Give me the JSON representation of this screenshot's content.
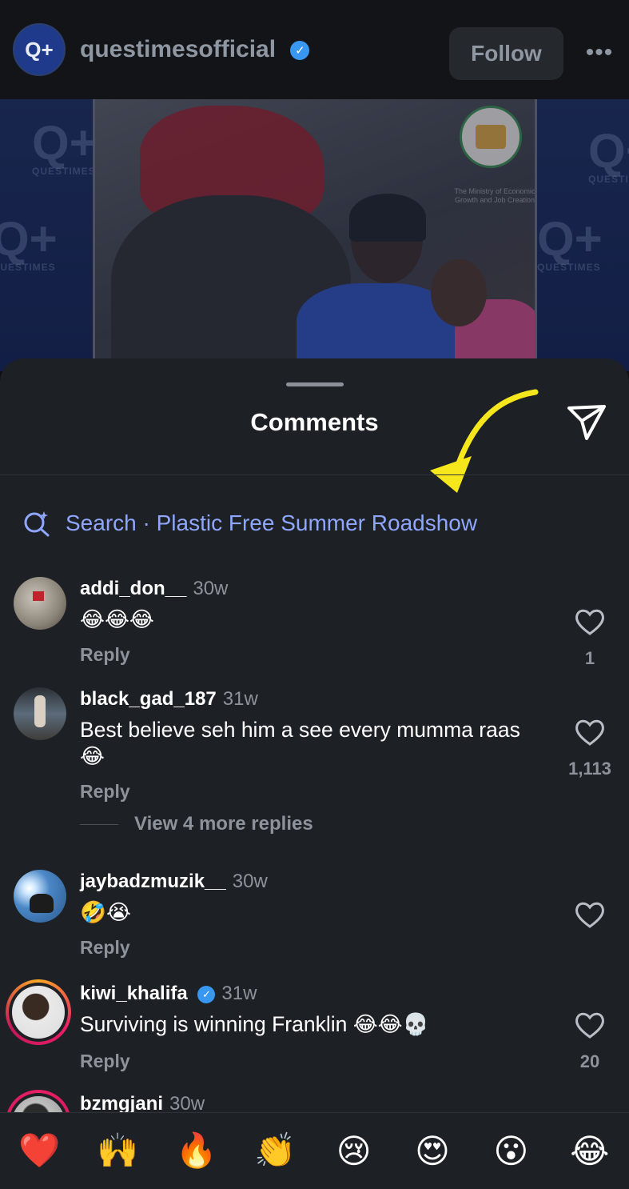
{
  "post": {
    "username": "questimesofficial",
    "avatar_text": "Q+",
    "follow_label": "Follow",
    "more_label": "•••",
    "verified": true
  },
  "video": {
    "watermark_text": "Q+",
    "watermark_sub": "QUESTIMES",
    "ministry_text": "The Ministry of Economic Growth and Job Creation"
  },
  "comments_sheet": {
    "title": "Comments",
    "search_label": "Search · Plastic Free Summer Roadshow",
    "comments": [
      {
        "username": "addi_don__",
        "time": "30w",
        "text": "😂😂😂",
        "reply_label": "Reply",
        "likes": "1",
        "verified": false
      },
      {
        "username": "black_gad_187",
        "time": "31w",
        "text": "Best believe seh him a see every mumma raas😂",
        "reply_label": "Reply",
        "likes": "1,113",
        "verified": false,
        "more_replies": "View 4 more replies"
      },
      {
        "username": "jaybadzmuzik__",
        "time": "30w",
        "text": "🤣😭",
        "reply_label": "Reply",
        "likes": "",
        "verified": false
      },
      {
        "username": "kiwi_khalifa",
        "time": "31w",
        "text": "Surviving is winning Franklin 😂😂💀",
        "reply_label": "Reply",
        "likes": "20",
        "verified": true
      },
      {
        "username": "bzmgjani",
        "time": "30w",
        "text": "",
        "reply_label": "",
        "likes": "",
        "verified": false
      }
    ]
  },
  "emoji_bar": [
    "❤️",
    "🙌",
    "🔥",
    "👏",
    "😢",
    "😍",
    "😮",
    "😂"
  ],
  "colors": {
    "sheet_bg": "#1d2024",
    "accent_link": "#8fa6ff",
    "verified_blue": "#3897f0",
    "arrow_yellow": "#f5e71c"
  }
}
